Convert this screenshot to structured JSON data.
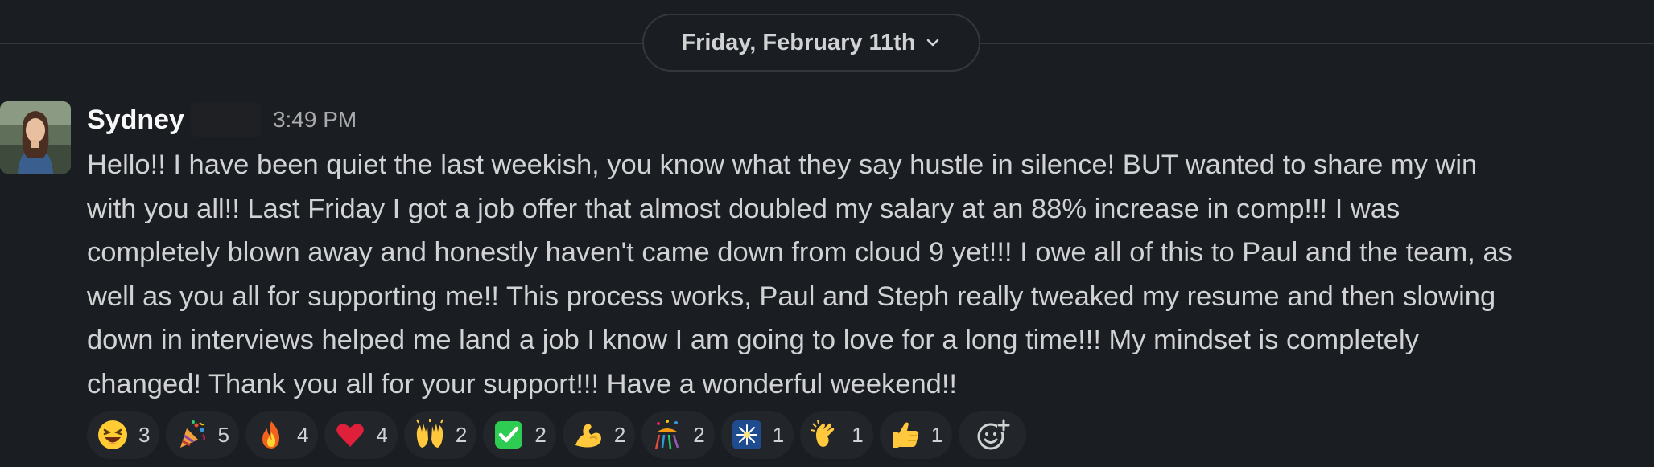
{
  "date_divider": {
    "label": "Friday, February 11th"
  },
  "message": {
    "author": "Sydney",
    "timestamp": "3:49 PM",
    "body_lines": [
      "Hello!! I have been quiet the last weekish, you know what they say hustle in silence! BUT wanted to share my win",
      "with you all!! Last Friday I got a job offer that almost doubled my salary at an 88% increase in comp!!! I was",
      "completely blown away and honestly haven't came down from cloud 9 yet!!! I owe all of this to Paul and the team, as",
      "well as you all for supporting me!! This process works, Paul and Steph really tweaked my resume and then slowing",
      "down in interviews helped me land a job I know I am going to love for a long time!!! My mindset is completely",
      "changed! Thank you all for your support!!! Have a wonderful weekend!!"
    ],
    "reactions": [
      {
        "emoji": "laughing-face",
        "count": "3"
      },
      {
        "emoji": "party-popper",
        "count": "5"
      },
      {
        "emoji": "fire",
        "count": "4"
      },
      {
        "emoji": "red-heart",
        "count": "4"
      },
      {
        "emoji": "raising-hands",
        "count": "2"
      },
      {
        "emoji": "check-mark-button",
        "count": "2"
      },
      {
        "emoji": "flexed-biceps",
        "count": "2"
      },
      {
        "emoji": "confetti-ball",
        "count": "2"
      },
      {
        "emoji": "sparkler",
        "count": "1"
      },
      {
        "emoji": "clapping-hands",
        "count": "1"
      },
      {
        "emoji": "thumbs-up",
        "count": "1"
      }
    ],
    "add_reaction_icon": "add-reaction-icon"
  },
  "colors": {
    "background": "#1a1d21",
    "text": "#d1d2d3",
    "muted": "#ababad",
    "pill_bg": "#222529",
    "border": "#35373b"
  }
}
